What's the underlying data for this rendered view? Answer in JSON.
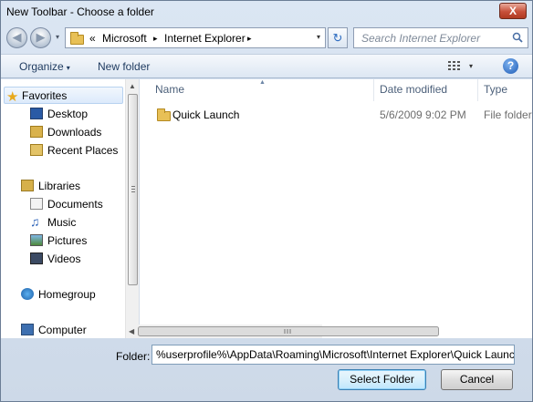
{
  "window": {
    "title": "New Toolbar - Choose a folder",
    "close_label": "X"
  },
  "address_bar": {
    "overflow_marker": "«",
    "crumbs": [
      "Microsoft",
      "Internet Explorer"
    ],
    "separator": "▸",
    "dropdown": "▾"
  },
  "search": {
    "placeholder": "Search Internet Explorer"
  },
  "toolbar": {
    "organize_label": "Organize",
    "new_folder_label": "New folder",
    "dropdown": "▾",
    "help": "?"
  },
  "nav_pane": {
    "groups": [
      {
        "label": "Favorites",
        "icon": "star-icon",
        "items": [
          {
            "label": "Desktop",
            "icon": "desktop-icon"
          },
          {
            "label": "Downloads",
            "icon": "downloads-icon"
          },
          {
            "label": "Recent Places",
            "icon": "recent-places-icon"
          }
        ]
      },
      {
        "label": "Libraries",
        "icon": "libraries-icon",
        "items": [
          {
            "label": "Documents",
            "icon": "documents-icon"
          },
          {
            "label": "Music",
            "icon": "music-icon"
          },
          {
            "label": "Pictures",
            "icon": "pictures-icon"
          },
          {
            "label": "Videos",
            "icon": "videos-icon"
          }
        ]
      },
      {
        "label": "Homegroup",
        "icon": "homegroup-icon",
        "items": []
      },
      {
        "label": "Computer",
        "icon": "computer-icon",
        "items": []
      }
    ]
  },
  "file_list": {
    "columns": [
      "Name",
      "Date modified",
      "Type"
    ],
    "rows": [
      {
        "name": "Quick Launch",
        "date_modified": "5/6/2009 9:02 PM",
        "type": "File folder"
      }
    ]
  },
  "footer": {
    "folder_label": "Folder:",
    "folder_value": "%userprofile%\\AppData\\Roaming\\Microsoft\\Internet Explorer\\Quick Launch",
    "select_button": "Select Folder",
    "cancel_button": "Cancel"
  },
  "colors": {
    "accent": "#3c7fb1",
    "folder": "#e8c056",
    "close": "#c7503a"
  }
}
